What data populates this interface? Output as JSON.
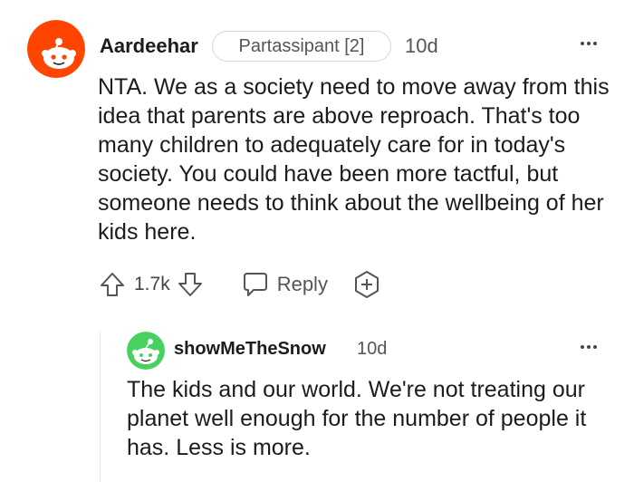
{
  "comment": {
    "username": "Aardeehar",
    "flair": "Partassipant [2]",
    "time": "10d",
    "body": "NTA. We as a society need to move away from this idea that parents are above reproach. That's too many children to adequately care for in today's society. You could have been more tactful, but someone needs to think about the wellbeing of her kids here.",
    "vote_count": "1.7k",
    "reply_label": "Reply",
    "avatar_color": "#ff4500",
    "icons": [
      "more-options-icon",
      "upvote-icon",
      "downvote-icon",
      "reply-bubble-icon",
      "award-icon"
    ]
  },
  "reply": {
    "username": "showMeTheSnow",
    "time": "10d",
    "body": "The kids and our world. We're not treating our planet well enough for the number of people it has. Less is more.",
    "avatar_color": "#46d160"
  }
}
